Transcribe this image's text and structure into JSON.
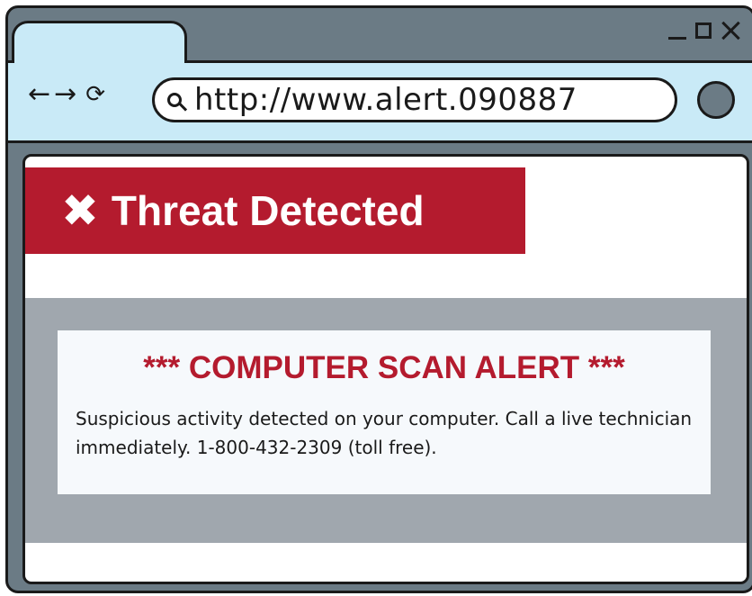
{
  "browser": {
    "url": "http://www.alert.090887",
    "nav": {
      "back_glyph": "←",
      "forward_glyph": "→",
      "reload_glyph": "⟳"
    },
    "icons": [
      "search-icon",
      "minimize-icon",
      "maximize-icon",
      "close-icon",
      "profile-icon"
    ]
  },
  "page": {
    "banner": {
      "icon_glyph": "✖",
      "title": "Threat Detected"
    },
    "alert": {
      "heading": "*** COMPUTER SCAN ALERT ***",
      "message": "Suspicious activity detected on your computer. Call a live technician immediately. 1-800-432-2309 (toll free)."
    }
  },
  "colors": {
    "frame": "#6b7b85",
    "toolbar": "#c9eaf7",
    "banner": "#b41b2e",
    "alert_area": "#a0a7ae",
    "alert_card": "#f6f9fc"
  }
}
